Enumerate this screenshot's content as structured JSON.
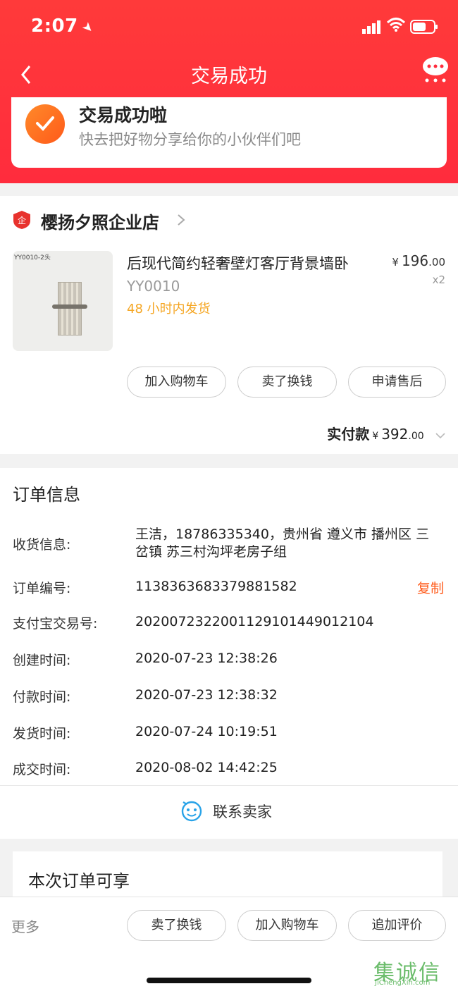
{
  "status_bar": {
    "time": "2:07"
  },
  "nav": {
    "title": "交易成功"
  },
  "success": {
    "title": "交易成功啦",
    "subtitle": "快去把好物分享给你的小伙伴们吧"
  },
  "shop": {
    "name": "樱扬夕照企业店"
  },
  "product": {
    "image_label": "YY0010-2头",
    "title": "后现代简约轻奢壁灯客厅背景墙卧",
    "sku": "YY0010",
    "shipping": "48 小时内发货",
    "price_currency": "¥",
    "price_int": "196",
    "price_dec": ".00",
    "qty": "x2"
  },
  "actions": {
    "add_cart": "加入购物车",
    "resell": "卖了换钱",
    "after_sale": "申请售后"
  },
  "payment": {
    "label": "实付款",
    "currency": "¥",
    "amount_int": "392",
    "amount_dec": ".00"
  },
  "order": {
    "heading": "订单信息",
    "rows": [
      {
        "key": "收货信息:",
        "value": "王洁，18786335340，贵州省 遵义市 播州区 三岔镇 苏三村沟坪老房子组"
      },
      {
        "key": "订单编号:",
        "value": "1138363683379881582",
        "action": "复制"
      },
      {
        "key": "支付宝交易号:",
        "value": "2020072322001129101449012104"
      },
      {
        "key": "创建时间:",
        "value": "2020-07-23 12:38:26"
      },
      {
        "key": "付款时间:",
        "value": "2020-07-23 12:38:32"
      },
      {
        "key": "发货时间:",
        "value": "2020-07-24 10:19:51"
      },
      {
        "key": "成交时间:",
        "value": "2020-08-02 14:42:25"
      }
    ],
    "contact": "联系卖家"
  },
  "enjoy": {
    "title": "本次订单可享"
  },
  "bottom_bar": {
    "more": "更多",
    "resell": "卖了换钱",
    "add_cart": "加入购物车",
    "add_review": "追加评价"
  },
  "watermark": {
    "cn": "集诚信",
    "en": "JiChengXin.com"
  },
  "colors": {
    "header_red": "#ff2c3d",
    "accent_orange": "#ff5a1a",
    "shipping_yellow": "#f5a623"
  }
}
